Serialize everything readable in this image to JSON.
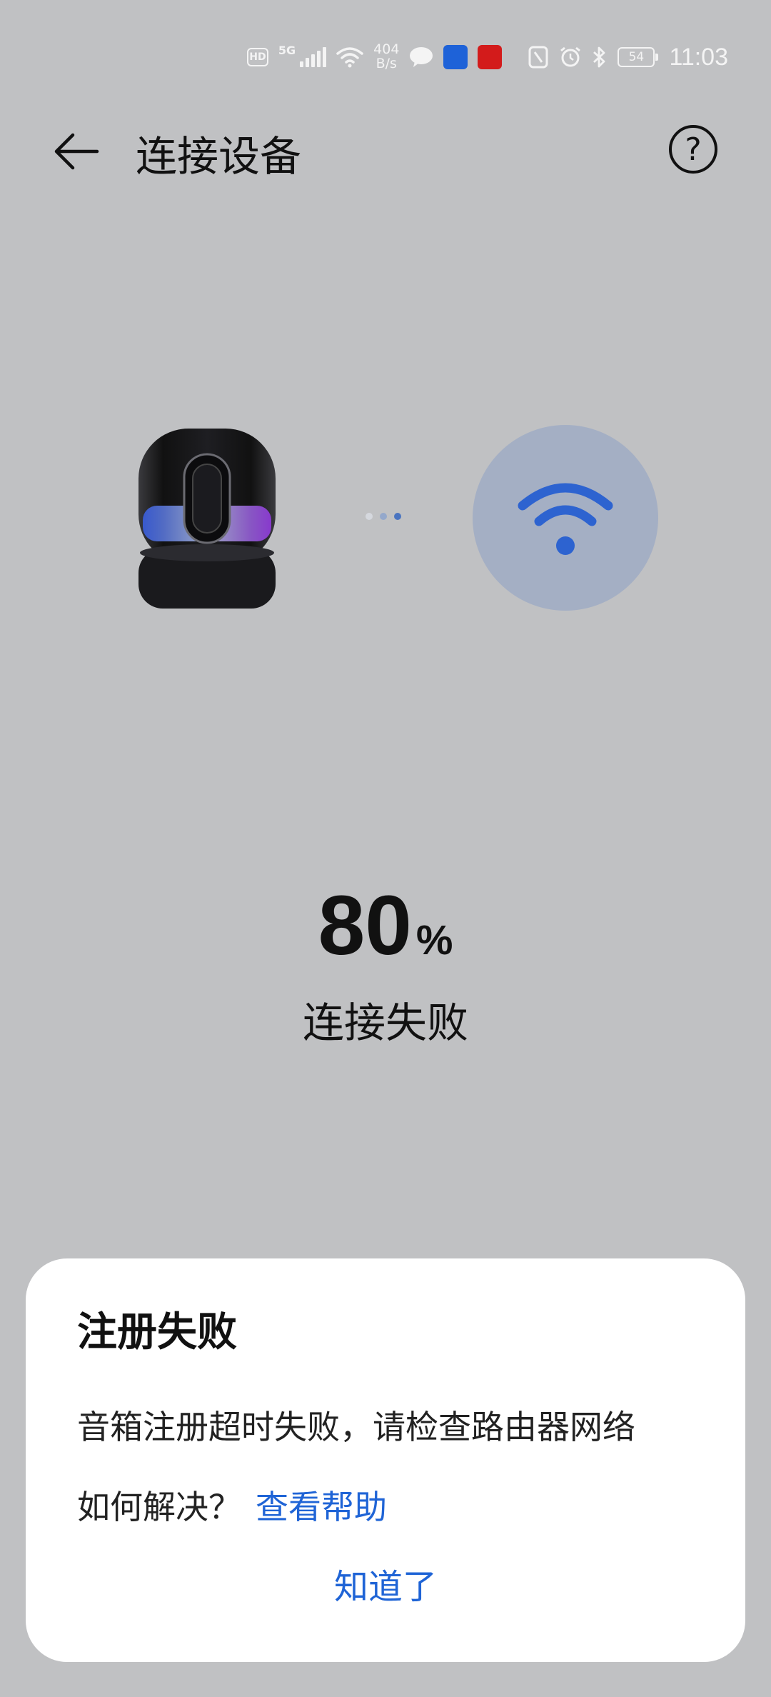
{
  "status_bar": {
    "hd": "HD",
    "network": "5G",
    "speed_value": "404",
    "speed_unit": "B/s",
    "battery": "54",
    "time": "11:03",
    "app_icons": [
      {
        "name": "chat-app-icon",
        "color": "#f4f4f4"
      },
      {
        "name": "blue-app-icon",
        "color": "#1e62d8"
      },
      {
        "name": "red-app-icon",
        "color": "#d31b1b"
      }
    ]
  },
  "header": {
    "title": "连接设备"
  },
  "connection": {
    "dot_colors": [
      "#d5d8de",
      "#94a8cb",
      "#4a74c0"
    ],
    "wifi_circle_color": "#a4afc4",
    "wifi_color": "#2d63d0"
  },
  "progress": {
    "value": "80",
    "unit": "%",
    "status": "连接失败"
  },
  "dialog": {
    "title": "注册失败",
    "message": "音箱注册超时失败，请检查路由器网络",
    "hint": "如何解决？",
    "help_link": "查看帮助",
    "confirm": "知道了"
  },
  "colors": {
    "background": "#c0c1c3",
    "accent": "#1f64d6"
  }
}
